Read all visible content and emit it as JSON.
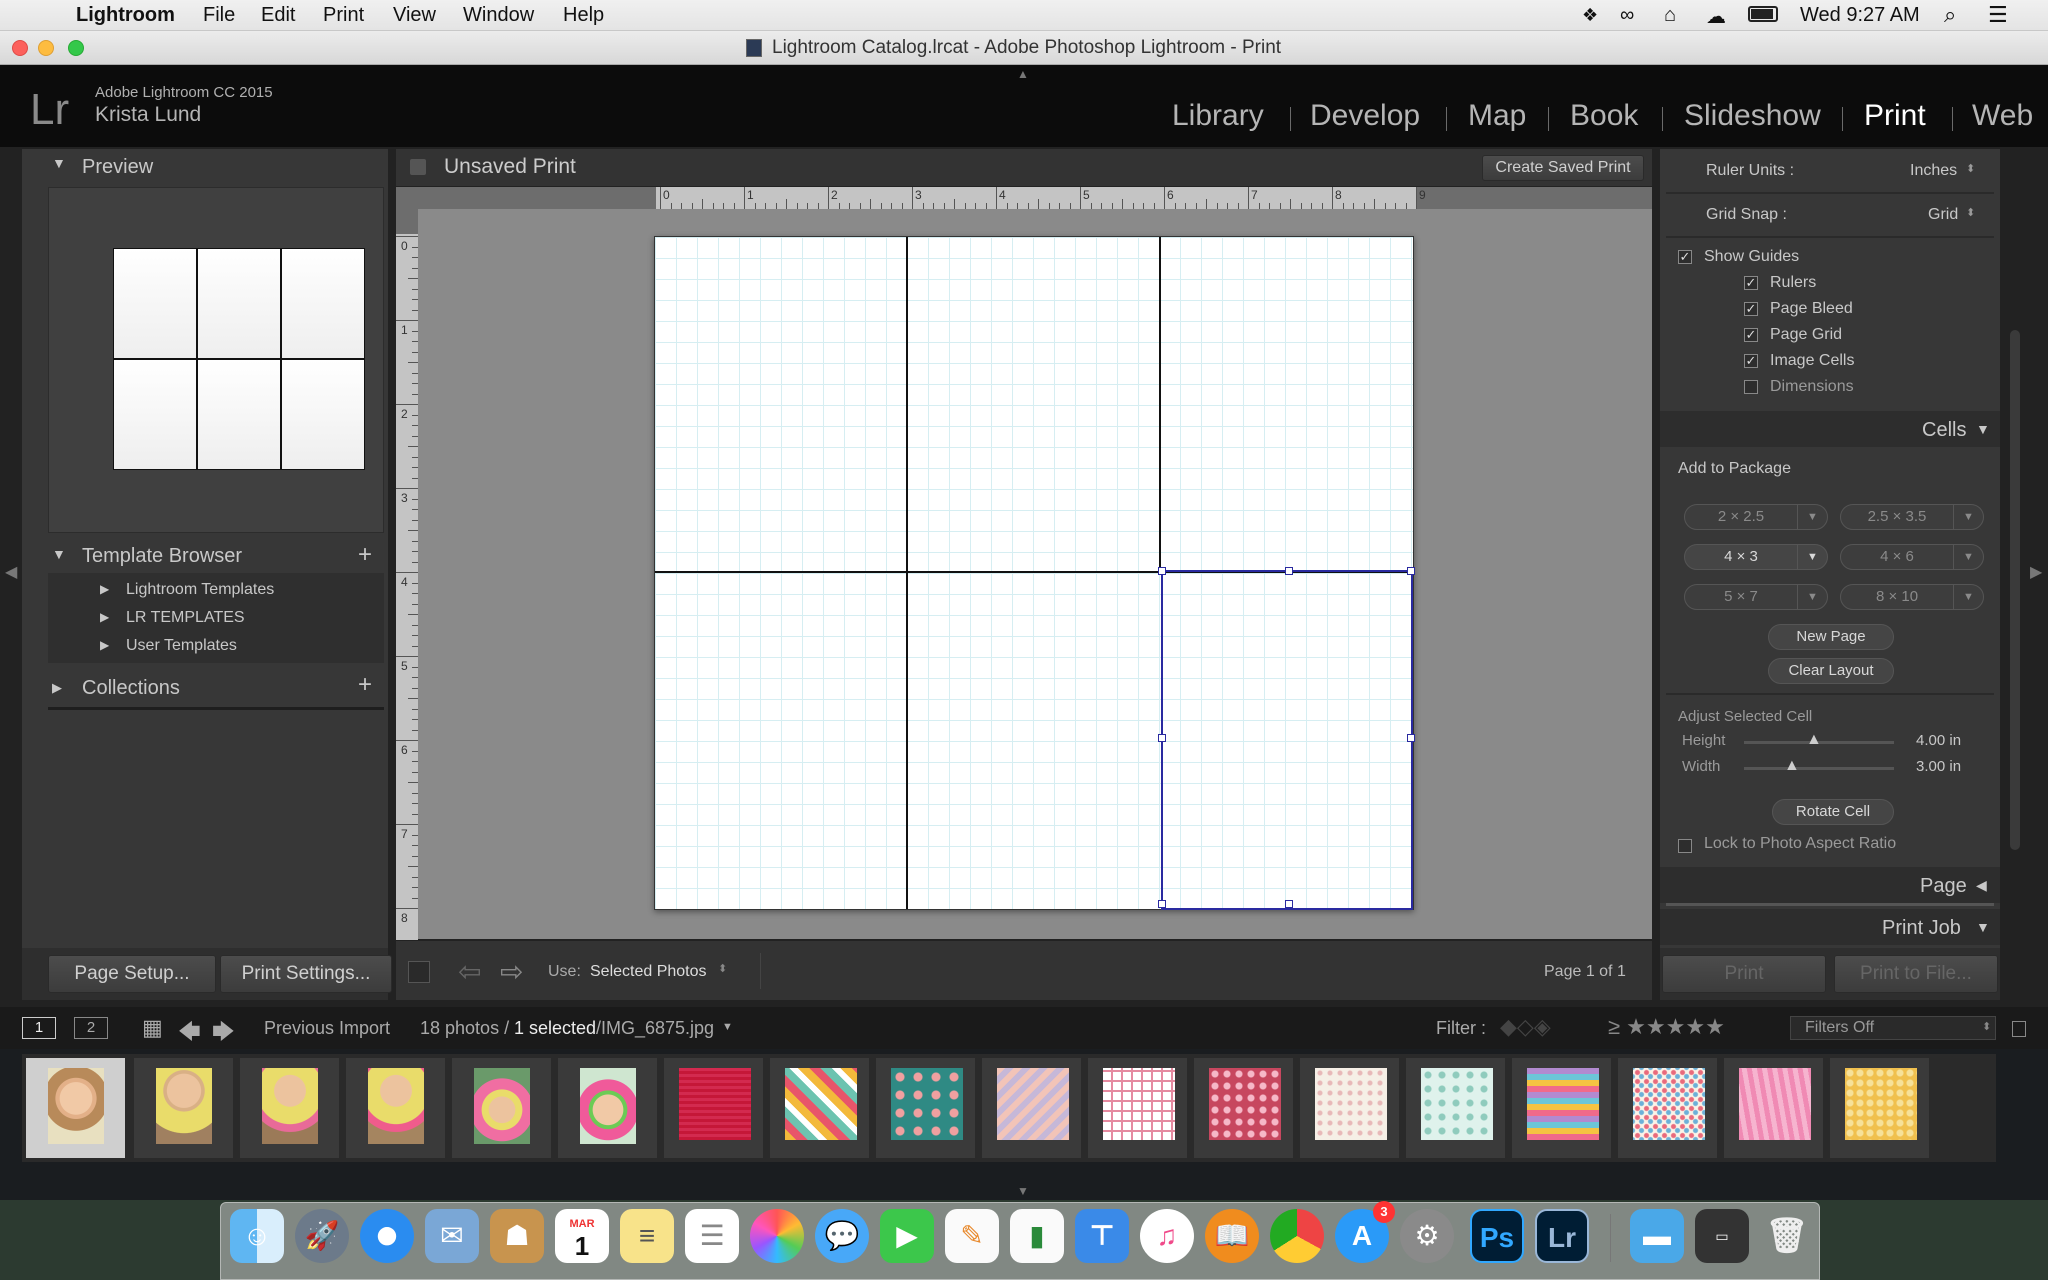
{
  "menubar": {
    "app": "Lightroom",
    "items": [
      "File",
      "Edit",
      "Print",
      "View",
      "Window",
      "Help"
    ],
    "clock": "Wed 9:27 AM"
  },
  "window": {
    "title": "Lightroom Catalog.lrcat - Adobe Photoshop Lightroom - Print"
  },
  "identity": {
    "logo": "Lr",
    "product": "Adobe Lightroom CC 2015",
    "user": "Krista Lund"
  },
  "modules": [
    "Library",
    "Develop",
    "Map",
    "Book",
    "Slideshow",
    "Print",
    "Web"
  ],
  "active_module": "Print",
  "left_panel": {
    "preview_title": "Preview",
    "template_browser_title": "Template Browser",
    "templates": [
      "Lightroom Templates",
      "LR TEMPLATES",
      "User Templates"
    ],
    "collections_title": "Collections",
    "page_setup": "Page Setup...",
    "print_settings": "Print Settings..."
  },
  "center": {
    "print_name": "Unsaved Print",
    "create_saved_print": "Create Saved Print",
    "ruler_h": [
      "0",
      "1",
      "2",
      "3",
      "4",
      "5",
      "6",
      "7",
      "8",
      "9"
    ],
    "ruler_v": [
      "0",
      "1",
      "2",
      "3",
      "4",
      "5",
      "6",
      "7",
      "8"
    ],
    "use_label": "Use:",
    "use_value": "Selected Photos",
    "page_info": "Page 1 of 1"
  },
  "right_panel": {
    "ruler_units_label": "Ruler Units :",
    "ruler_units_value": "Inches",
    "grid_snap_label": "Grid Snap :",
    "grid_snap_value": "Grid",
    "show_guides": "Show Guides",
    "guides": [
      {
        "label": "Rulers",
        "checked": true
      },
      {
        "label": "Page Bleed",
        "checked": true
      },
      {
        "label": "Page Grid",
        "checked": true
      },
      {
        "label": "Image Cells",
        "checked": true
      },
      {
        "label": "Dimensions",
        "checked": false
      }
    ],
    "cells_title": "Cells",
    "add_to_package": "Add to Package",
    "sizes": [
      "2 × 2.5",
      "2.5 × 3.5",
      "4 × 3",
      "4 × 6",
      "5 × 7",
      "8 × 10"
    ],
    "new_page": "New Page",
    "clear_layout": "Clear Layout",
    "adjust_title": "Adjust Selected Cell",
    "height_label": "Height",
    "height_value": "4.00 in",
    "width_label": "Width",
    "width_value": "3.00 in",
    "rotate_cell": "Rotate Cell",
    "lock_aspect": "Lock to Photo Aspect Ratio",
    "page_title": "Page",
    "print_job_title": "Print Job",
    "print_btn": "Print",
    "print_to_file": "Print to File..."
  },
  "filmstrip": {
    "screen1": "1",
    "screen2": "2",
    "source": "Previous Import",
    "count": "18 photos /",
    "selected": "1 selected",
    "file": "/IMG_6875.jpg",
    "filter_label": "Filter :",
    "filter_value": "Filters Off"
  },
  "dock": {
    "badge": "3",
    "cal_month": "MAR",
    "cal_day": "1"
  },
  "colors": {
    "guide_line": "#2a2aa0",
    "page_grid": "#cfe9ee",
    "panel_bg": "#373737"
  }
}
